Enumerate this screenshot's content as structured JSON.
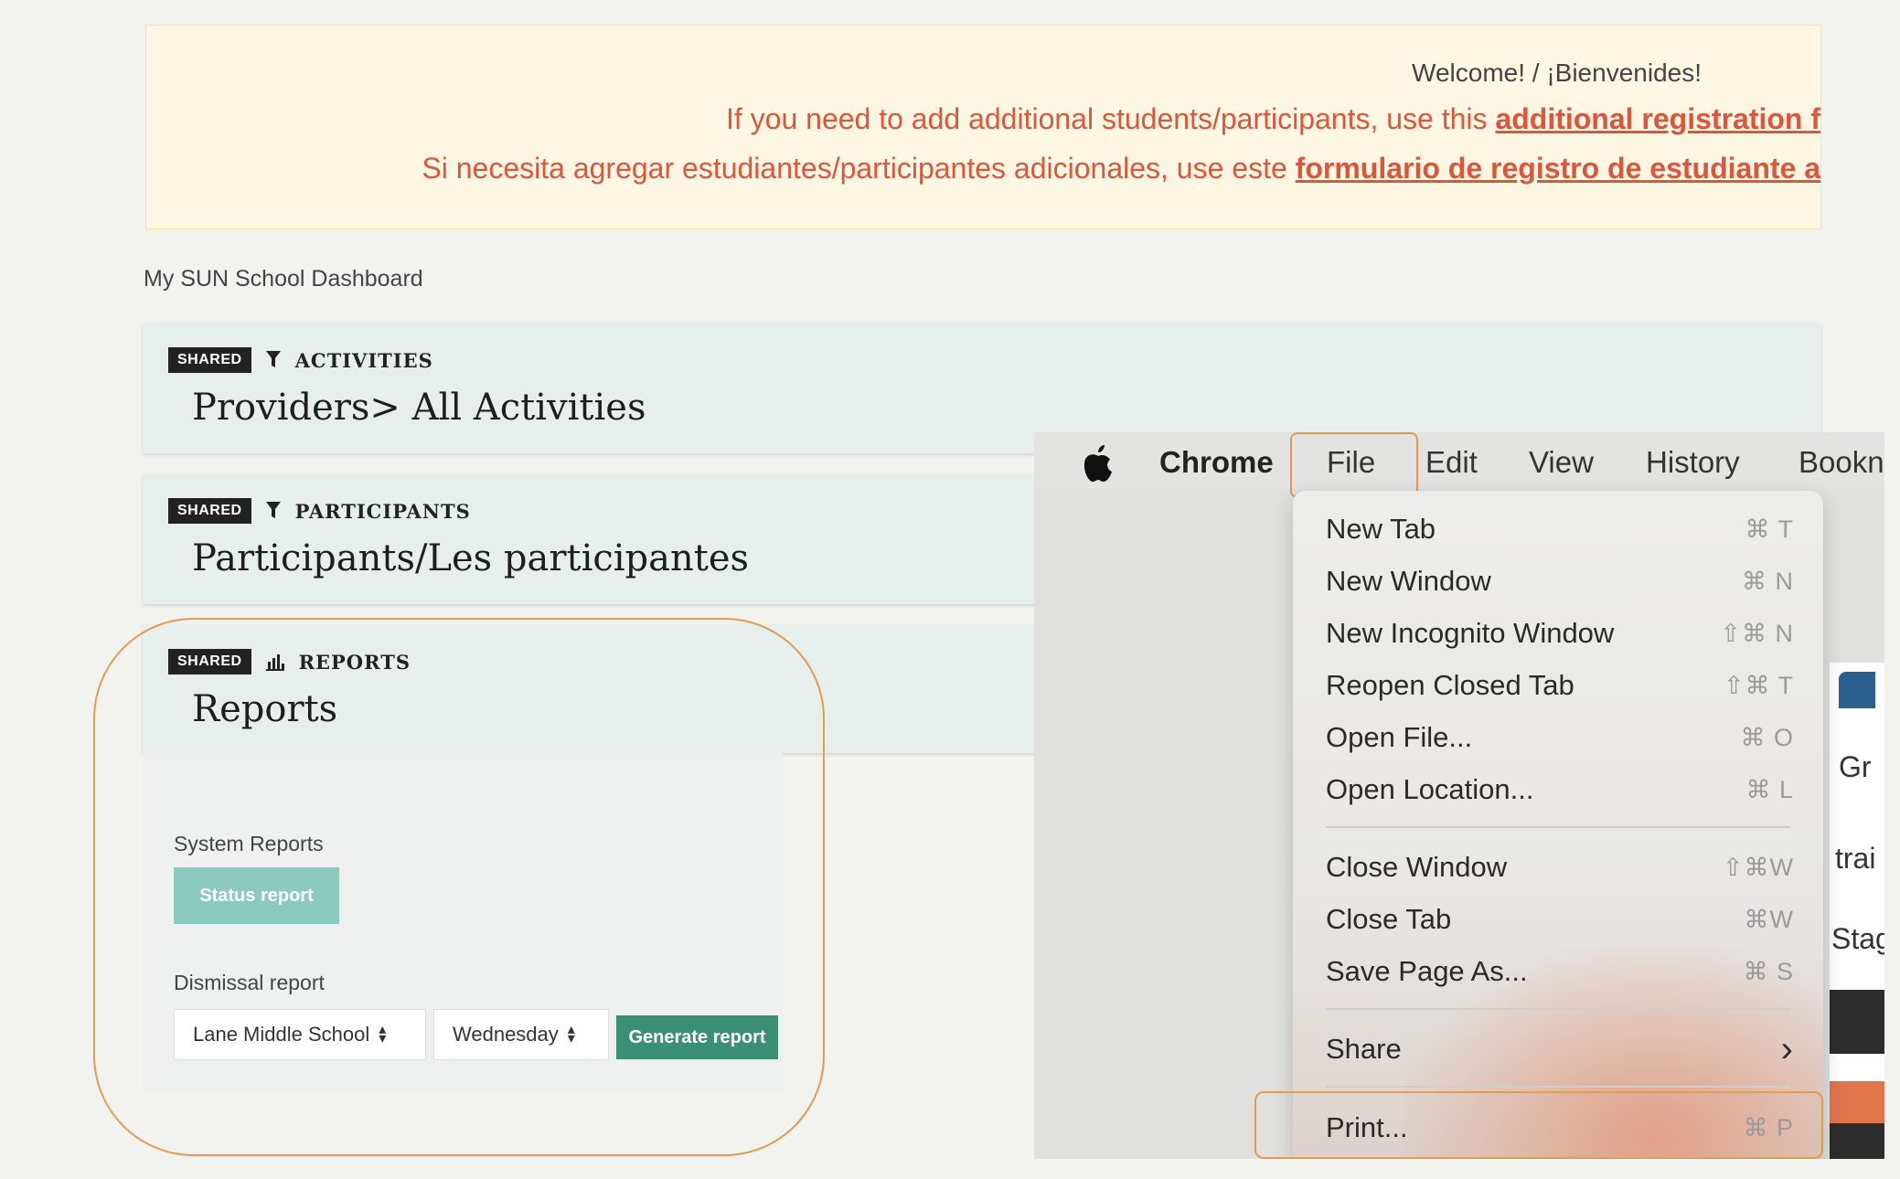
{
  "banner": {
    "welcome": "Welcome! / ¡Bienvenides!",
    "line1_prefix": "If you need to add additional students/participants, use this ",
    "line1_link": "additional registration f",
    "line2_prefix": "Si necesita agregar estudiantes/participantes adicionales, use este ",
    "line2_link": "formulario de registro de estudiante a"
  },
  "dashboard_title": "My SUN School Dashboard",
  "cards": [
    {
      "badge": "SHARED",
      "icon": "filter-icon",
      "category": "ACTIVITIES",
      "title": "Providers> All Activities"
    },
    {
      "badge": "SHARED",
      "icon": "filter-icon",
      "category": "PARTICIPANTS",
      "title": "Participants/Les participantes"
    },
    {
      "badge": "SHARED",
      "icon": "bar-chart-icon",
      "category": "REPORTS",
      "title": "Reports"
    }
  ],
  "reports": {
    "system_reports_label": "System Reports",
    "status_button": "Status report",
    "dismissal_label": "Dismissal report",
    "school_select": "Lane Middle School",
    "day_select": "Wednesday",
    "generate_button": "Generate report"
  },
  "mac_menu": {
    "menubar": [
      "Chrome",
      "File",
      "Edit",
      "View",
      "History",
      "Bookn"
    ],
    "file_items": [
      {
        "label": "New Tab",
        "shortcut": "⌘ T"
      },
      {
        "label": "New Window",
        "shortcut": "⌘ N"
      },
      {
        "label": "New Incognito Window",
        "shortcut": "⇧⌘ N"
      },
      {
        "label": "Reopen Closed Tab",
        "shortcut": "⇧⌘ T"
      },
      {
        "label": "Open File...",
        "shortcut": "⌘ O"
      },
      {
        "label": "Open Location...",
        "shortcut": "⌘ L"
      },
      {
        "label": "Close Window",
        "shortcut": "⇧⌘W"
      },
      {
        "label": "Close Tab",
        "shortcut": "⌘W"
      },
      {
        "label": "Save Page As...",
        "shortcut": "⌘ S"
      },
      {
        "label": "Share",
        "shortcut": "›"
      },
      {
        "label": "Print...",
        "shortcut": "⌘ P"
      }
    ],
    "background_fragments": [
      "Gr",
      "trai",
      "Stag"
    ]
  },
  "accent_colors": {
    "highlight": "#e39a52",
    "banner_text": "#d9573d",
    "status_button": "#8ccabd",
    "generate_button": "#3a8f75"
  }
}
